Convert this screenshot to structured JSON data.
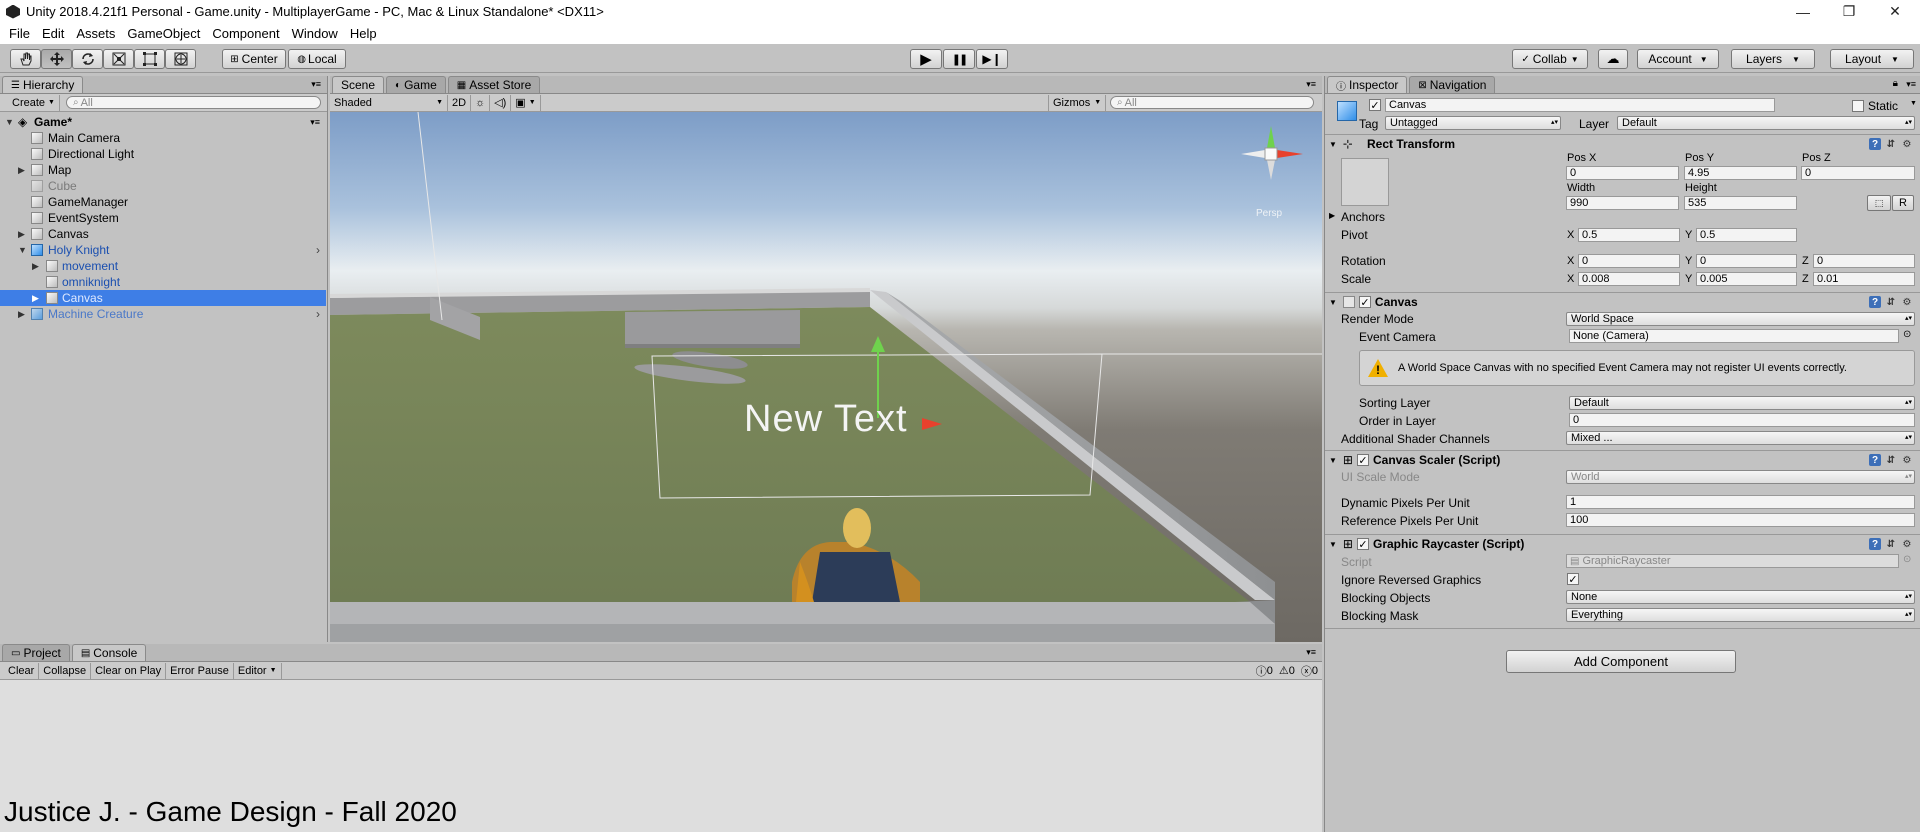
{
  "window": {
    "title": "Unity 2018.4.21f1 Personal - Game.unity - MultiplayerGame - PC, Mac & Linux Standalone* <DX11>",
    "minimize": "—",
    "maximize": "❐",
    "close": "✕"
  },
  "menu": [
    "File",
    "Edit",
    "Assets",
    "GameObject",
    "Component",
    "Window",
    "Help"
  ],
  "toolbar": {
    "tools": [
      "hand-icon",
      "move-icon",
      "rotate-icon",
      "scale-icon",
      "rect-icon",
      "transform-icon"
    ],
    "pivot": "Center",
    "space": "Local",
    "play": "▶",
    "pause": "❚❚",
    "step": "▶❙",
    "collab": "Collab",
    "cloud": "☁",
    "account": "Account",
    "layers": "Layers",
    "layout": "Layout"
  },
  "hierarchy": {
    "tab": "Hierarchy",
    "create": "Create",
    "search_placeholder": "All",
    "scene": "Game*",
    "items": [
      {
        "label": "Main Camera"
      },
      {
        "label": "Directional Light"
      },
      {
        "label": "Map"
      },
      {
        "label": "Cube"
      },
      {
        "label": "GameManager"
      },
      {
        "label": "EventSystem"
      },
      {
        "label": "Canvas"
      },
      {
        "label": "Holy Knight"
      },
      {
        "label": "movement"
      },
      {
        "label": "omniknight"
      },
      {
        "label": "Canvas"
      },
      {
        "label": "Machine Creature"
      }
    ]
  },
  "scene_view": {
    "tabs": [
      "Scene",
      "Game",
      "Asset Store"
    ],
    "shading": "Shaded",
    "mode_2d": "2D",
    "gizmos": "Gizmos",
    "search_placeholder": "All",
    "world_text": "New Text",
    "persp_label": "Persp"
  },
  "inspector": {
    "tabs": [
      "Inspector",
      "Navigation"
    ],
    "object_name": "Canvas",
    "static_label": "Static",
    "tag_label": "Tag",
    "tag_value": "Untagged",
    "layer_label": "Layer",
    "layer_value": "Default",
    "rect_transform": {
      "title": "Rect Transform",
      "pos_x_label": "Pos X",
      "pos_y_label": "Pos Y",
      "pos_z_label": "Pos Z",
      "pos_x": "0",
      "pos_y": "4.95",
      "pos_z": "0",
      "width_label": "Width",
      "height_label": "Height",
      "width": "990",
      "height": "535",
      "r_button": "R",
      "anchors_label": "Anchors",
      "pivot_label": "Pivot",
      "pivot_x": "0.5",
      "pivot_y": "0.5",
      "rotation_label": "Rotation",
      "rot_x": "0",
      "rot_y": "0",
      "rot_z": "0",
      "scale_label": "Scale",
      "scale_x": "0.008",
      "scale_y": "0.005",
      "scale_z": "0.01",
      "x": "X",
      "y": "Y",
      "z": "Z"
    },
    "canvas": {
      "title": "Canvas",
      "render_mode_label": "Render Mode",
      "render_mode": "World Space",
      "event_camera_label": "Event Camera",
      "event_camera": "None (Camera)",
      "warning": "A World Space Canvas with no specified Event Camera may not register UI events correctly.",
      "sorting_layer_label": "Sorting Layer",
      "sorting_layer": "Default",
      "order_label": "Order in Layer",
      "order": "0",
      "shader_channels_label": "Additional Shader Channels",
      "shader_channels": "Mixed ..."
    },
    "canvas_scaler": {
      "title": "Canvas Scaler (Script)",
      "ui_scale_label": "UI Scale Mode",
      "ui_scale": "World",
      "dynamic_label": "Dynamic Pixels Per Unit",
      "dynamic": "1",
      "reference_label": "Reference Pixels Per Unit",
      "reference": "100"
    },
    "raycaster": {
      "title": "Graphic Raycaster (Script)",
      "script_label": "Script",
      "script": "GraphicRaycaster",
      "ignore_label": "Ignore Reversed Graphics",
      "blocking_objects_label": "Blocking Objects",
      "blocking_objects": "None",
      "blocking_mask_label": "Blocking Mask",
      "blocking_mask": "Everything"
    },
    "add_component": "Add Component"
  },
  "console": {
    "tabs": [
      "Project",
      "Console"
    ],
    "buttons": [
      "Clear",
      "Collapse",
      "Clear on Play",
      "Error Pause",
      "Editor"
    ],
    "info_count": "0",
    "warn_count": "0",
    "error_count": "0"
  },
  "footer": "Justice J. - Game Design - Fall 2020"
}
